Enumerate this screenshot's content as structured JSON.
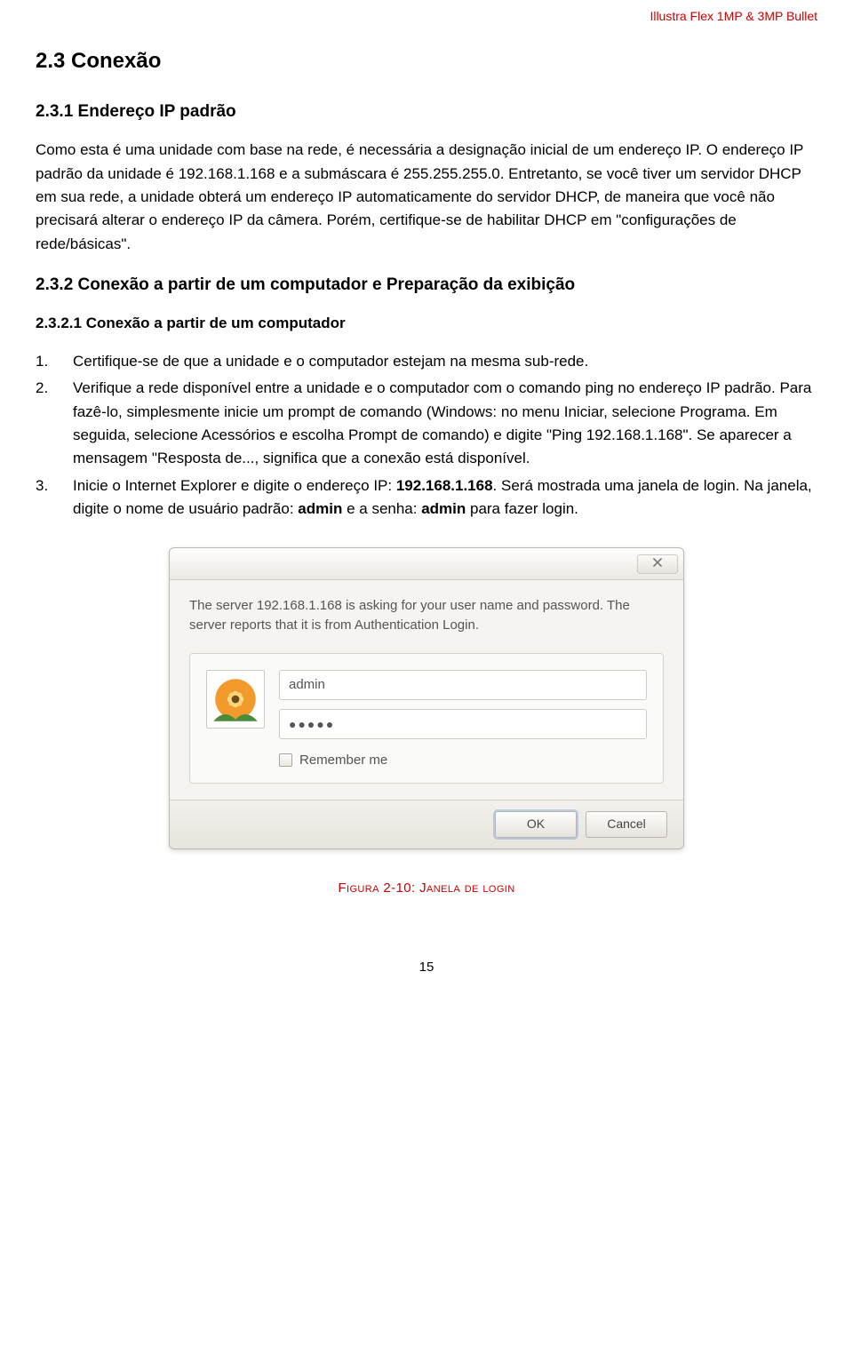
{
  "header": {
    "running": "Illustra Flex 1MP & 3MP Bullet"
  },
  "sec23": {
    "title": "2.3 Conexão"
  },
  "sec231": {
    "title": "2.3.1 Endereço IP padrão",
    "para": "Como esta é uma unidade com base na rede, é necessária a designação inicial de um endereço IP. O endereço IP padrão da unidade é 192.168.1.168 e a submáscara é 255.255.255.0. Entretanto, se você tiver um servidor DHCP em sua rede, a unidade obterá um endereço IP automaticamente do servidor DHCP, de maneira que você não precisará alterar o endereço IP da câmera. Porém, certifique-se de habilitar DHCP em \"configurações de rede/básicas\"."
  },
  "sec232": {
    "title": "2.3.2 Conexão a partir de um computador e Preparação da exibição",
    "sub1": {
      "title": "2.3.2.1 Conexão a partir de um computador",
      "items": [
        {
          "num": "1.",
          "text": "Certifique-se de que a unidade e o computador estejam na mesma sub-rede."
        },
        {
          "num": "2.",
          "text": "Verifique a rede disponível entre a unidade e o computador com o comando ping no endereço IP padrão. Para fazê-lo, simplesmente inicie um prompt de comando (Windows: no menu Iniciar, selecione Programa. Em seguida, selecione Acessórios e escolha Prompt de comando) e digite \"Ping 192.168.1.168\". Se aparecer a mensagem \"Resposta de..., significa que a conexão está disponível."
        },
        {
          "num": "3.",
          "text_before": "Inicie o Internet Explorer e digite o endereço IP: ",
          "bold1": "192.168.1.168",
          "mid1": ". Será mostrada uma janela de login. Na janela, digite o nome de usuário padrão: ",
          "bold2": "admin",
          "mid2": " e a senha: ",
          "bold3": "admin",
          "after": " para fazer login."
        }
      ]
    }
  },
  "dialog": {
    "message": "The server 192.168.1.168 is asking for your user name and password. The server reports that it is from Authentication Login.",
    "username_value": "admin",
    "password_masked": "●●●●●",
    "remember_label": "Remember me",
    "ok_label": "OK",
    "cancel_label": "Cancel"
  },
  "figure": {
    "caption_prefix": "Figura 2-10: ",
    "caption_body": "Janela de login"
  },
  "page_number": "15"
}
